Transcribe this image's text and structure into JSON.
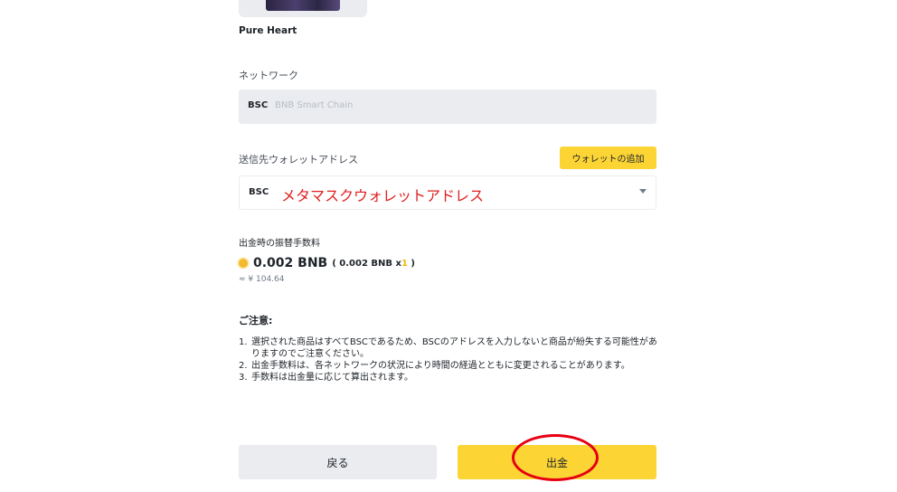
{
  "nft": {
    "name": "Pure Heart"
  },
  "network": {
    "label": "ネットワーク",
    "code": "BSC",
    "name": "BNB Smart Chain"
  },
  "address": {
    "label": "送信先ウォレットアドレス",
    "add_wallet_label": "ウォレットの追加",
    "code": "BSC",
    "value": "メタマスクウォレットアドレス"
  },
  "fee": {
    "label": "出金時の振替手数料",
    "amount": "0.002 BNB",
    "detail_open": "( 0.002 BNB x",
    "multiplier": "1",
    "detail_close": ")",
    "fiat": "≈ ¥ 104.64"
  },
  "notes": {
    "title": "ご注意:",
    "items": [
      {
        "num": "1.",
        "text": "選択された商品はすべてBSCであるため、BSCのアドレスを入力しないと商品が紛失する可能性がありますのでご注意ください。"
      },
      {
        "num": "2.",
        "text": "出金手数料は、各ネットワークの状況により時間の経過とともに変更されることがあります。"
      },
      {
        "num": "3.",
        "text": "手数料は出金量に応じて算出されます。"
      }
    ]
  },
  "actions": {
    "back_label": "戻る",
    "withdraw_label": "出金"
  },
  "colors": {
    "accent": "#fcd535",
    "annotation": "#e60012"
  }
}
